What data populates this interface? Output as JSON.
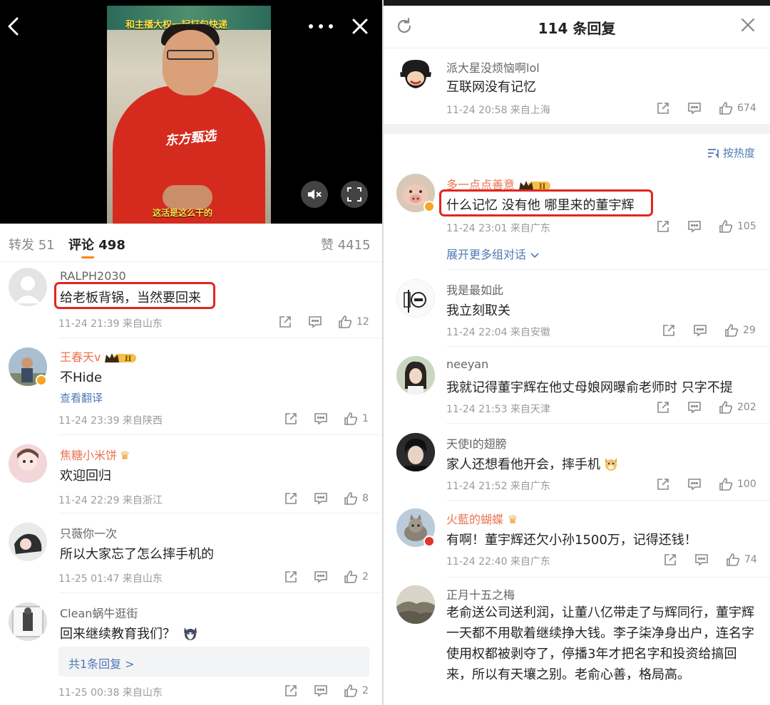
{
  "left": {
    "video": {
      "banner_text": "和主播大权一起打包快递",
      "hoodie_text": "东方甄选",
      "caption": "这活是这么干的"
    },
    "tabs": {
      "repost": "转发 51",
      "comments": "评论 498",
      "likes": "赞 4415"
    },
    "comments": [
      {
        "name": "RALPH2030",
        "text": "给老板背锅，当然要回来",
        "time": "11-24 21:39 来自山东",
        "likes": "12"
      },
      {
        "name": "王春天v",
        "text": "不Hide",
        "translate": "查看翻译",
        "time": "11-24 23:39 来自陕西",
        "likes": "1"
      },
      {
        "name": "焦糖小米饼",
        "text": "欢迎回归",
        "time": "11-24 22:29 来自浙江",
        "likes": "8"
      },
      {
        "name": "只薇你一次",
        "text": "所以大家忘了怎么摔手机的",
        "time": "11-25 01:47 来自山东",
        "likes": "2"
      },
      {
        "name": "Clean蜗牛逛街",
        "text": "回来继续教育我们？",
        "reply_box": "共1条回复 >",
        "time": "11-25 00:38 来自山东",
        "likes": "2"
      }
    ]
  },
  "right": {
    "title": "114 条回复",
    "top_comment": {
      "name": "派大星没烦恼啊lol",
      "text": "互联网没有记忆",
      "time": "11-24 20:58 来自上海",
      "likes": "674"
    },
    "sort_label": "按热度",
    "expand_label": "展开更多组对话",
    "replies": [
      {
        "name": "多一点点善意",
        "text": "什么记忆 没有他 哪里来的董宇辉",
        "time": "11-24 23:01 来自广东",
        "likes": "105"
      },
      {
        "name": "我是最如此",
        "text": "我立刻取关",
        "time": "11-24 22:04 来自安徽",
        "likes": "29"
      },
      {
        "name": "neeyan",
        "text": "我就记得董宇辉在他丈母娘网曝俞老师时 只字不提",
        "time": "11-24 21:53 来自天津",
        "likes": "202"
      },
      {
        "name": "天使I的翅膀",
        "text": "家人还想看他开会，摔手机",
        "time": "11-24 21:52 来自广东",
        "likes": "100"
      },
      {
        "name": "火藍的蝴蝶",
        "text": "有啊！董宇辉还欠小孙1500万，记得还钱！",
        "time": "11-24 22:40 来自广东",
        "likes": "74"
      },
      {
        "name": "正月十五之梅",
        "text": "老俞送公司送利润，让董八亿带走了与辉同行，董宇辉一天都不用歇着继续挣大钱。李子柒净身出户，连名字使用权都被剥夺了，停播3年才把名字和投资给搞回来，所以有天壤之别。老俞心善，格局高。"
      }
    ]
  },
  "colors": {
    "accent": "#ff8200",
    "link": "#5079b5",
    "highlight": "#e0261f",
    "vip_name": "#eb7350"
  }
}
